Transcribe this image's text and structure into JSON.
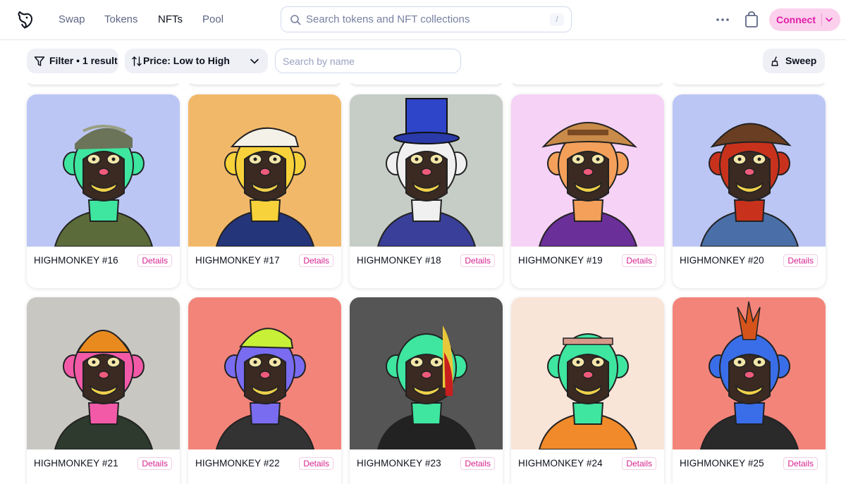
{
  "nav": {
    "links": [
      "Swap",
      "Tokens",
      "NFTs",
      "Pool"
    ],
    "active": "NFTs",
    "search_placeholder": "Search tokens and NFT collections",
    "search_shortcut": "/",
    "connect_label": "Connect"
  },
  "filters": {
    "filter_label": "Filter • 1 result",
    "sort_label": "Price: Low to High",
    "name_search_placeholder": "Search by name",
    "sweep_label": "Sweep"
  },
  "details_label": "Details",
  "colors": {
    "brand_pink": "#e11da7",
    "connect_bg": "#fbd0ec"
  },
  "cards": [
    {
      "name": "HIGHMONKEY #16",
      "bg": "#bcc6f5",
      "fur": "#3ee6a0",
      "hat": "cap-camo",
      "clothes": "#5b6b3a"
    },
    {
      "name": "HIGHMONKEY #17",
      "bg": "#f2b86a",
      "fur": "#f7d23a",
      "hat": "flatcap-white",
      "clothes": "#24357a"
    },
    {
      "name": "HIGHMONKEY #18",
      "bg": "#c6ccc6",
      "fur": "#f0f0f0",
      "hat": "tophat-blue",
      "clothes": "#3a3f9a"
    },
    {
      "name": "HIGHMONKEY #19",
      "bg": "#f6d2f6",
      "fur": "#f5a05a",
      "hat": "safari",
      "clothes": "#6b2f9a"
    },
    {
      "name": "HIGHMONKEY #20",
      "bg": "#bcc6f5",
      "fur": "#c8321c",
      "hat": "fedora-brown",
      "clothes": "#4a6fa8"
    },
    {
      "name": "HIGHMONKEY #21",
      "bg": "#c9c7c2",
      "fur": "#f25aa8",
      "hat": "beanie-orange",
      "clothes": "#2d3a2d"
    },
    {
      "name": "HIGHMONKEY #22",
      "bg": "#f3847a",
      "fur": "#7a6cf0",
      "hat": "cap-lime",
      "clothes": "#333333"
    },
    {
      "name": "HIGHMONKEY #23",
      "bg": "#555555",
      "fur": "#3ee6a0",
      "hat": "none",
      "clothes": "#222222"
    },
    {
      "name": "HIGHMONKEY #24",
      "bg": "#f9e4d8",
      "fur": "#3ee6a0",
      "hat": "headband",
      "clothes": "#f08a2a"
    },
    {
      "name": "HIGHMONKEY #25",
      "bg": "#f3847a",
      "fur": "#3a6ee8",
      "hat": "mohawk",
      "clothes": "#2a2a2a"
    }
  ]
}
